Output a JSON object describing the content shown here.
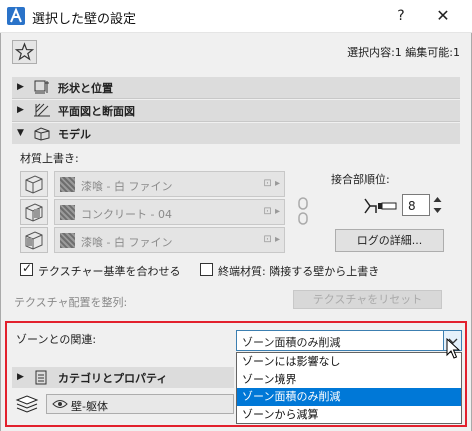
{
  "window": {
    "title": "選択した壁の設定",
    "help_label": "?",
    "close_label": "✕"
  },
  "header": {
    "selection_info": "選択内容:1 編集可能:1"
  },
  "sections": {
    "shape": "形状と位置",
    "plan": "平面図と断面図",
    "model": "モデル",
    "category": "カテゴリとプロパティ"
  },
  "model": {
    "override_label": "材質上書き:",
    "materials": [
      {
        "name": "漆喰 - 白 ファイン"
      },
      {
        "name": "コンクリート - 04"
      },
      {
        "name": "漆喰 - 白 ファイン"
      }
    ],
    "junction_label": "接合部順位:",
    "junction_value": "8",
    "log_button": "ログの詳細...",
    "texture_align_label": "テクスチャー基準を合わせる",
    "texture_align_checked": true,
    "end_material_label": "終端材質: 隣接する壁から上書き",
    "end_material_checked": false,
    "texture_arrange_label": "テクスチャ配置を整列:",
    "texture_reset_button": "テクスチャをリセット"
  },
  "zone": {
    "label": "ゾーンとの関連:",
    "selected": "ゾーン面積のみ削減",
    "options": [
      "ゾーンには影響なし",
      "ゾーン境界",
      "ゾーン面積のみ削減",
      "ゾーンから減算"
    ],
    "highlighted_index": 2
  },
  "layer": {
    "name": "壁-躯体"
  },
  "colors": {
    "accent": "#0078d7",
    "highlight_frame": "#e2202d"
  }
}
